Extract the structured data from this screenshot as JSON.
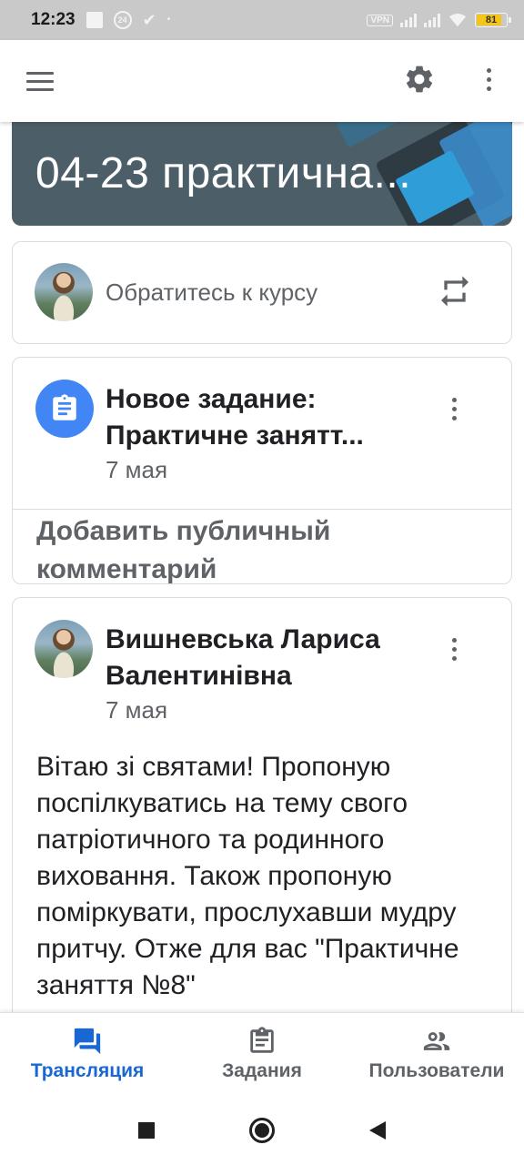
{
  "status_bar": {
    "time": "12:23",
    "notification_badge": "24",
    "vpn": "VPN",
    "battery": "81"
  },
  "app_bar": {
    "menu_icon": "menu-icon",
    "settings_icon": "gear-icon",
    "more_icon": "more-vert-icon"
  },
  "banner": {
    "title": "04-23 практична..."
  },
  "course_card": {
    "text": "Обратитесь к курсу",
    "icon": "repeat-icon"
  },
  "task_card": {
    "icon": "assignment-icon",
    "title": "Новое задание: Практичне занятт...",
    "date": "7 мая",
    "comment_link": "Добавить публичный комментарий"
  },
  "post_card": {
    "author": "Вишневська Лариса Валентинівна",
    "date": "7 мая",
    "body": "Вітаю зі святами! Пропоную поспілкуватись на тему свого патріотичного та родинного виховання. Також пропоную поміркувати, прослухавши мудру притчу. Отже для вас \"Практичне заняття №8\""
  },
  "bottom_nav": {
    "items": [
      {
        "label": "Трансляция",
        "icon": "forum-icon",
        "active": true
      },
      {
        "label": "Задания",
        "icon": "assignment-icon",
        "active": false
      },
      {
        "label": "Пользователи",
        "icon": "people-icon",
        "active": false
      }
    ]
  },
  "colors": {
    "accent": "#1967d2",
    "task_icon_bg": "#4285f4",
    "banner_bg": "#4c5f69",
    "status_bar_bg": "#c9c9c9"
  }
}
